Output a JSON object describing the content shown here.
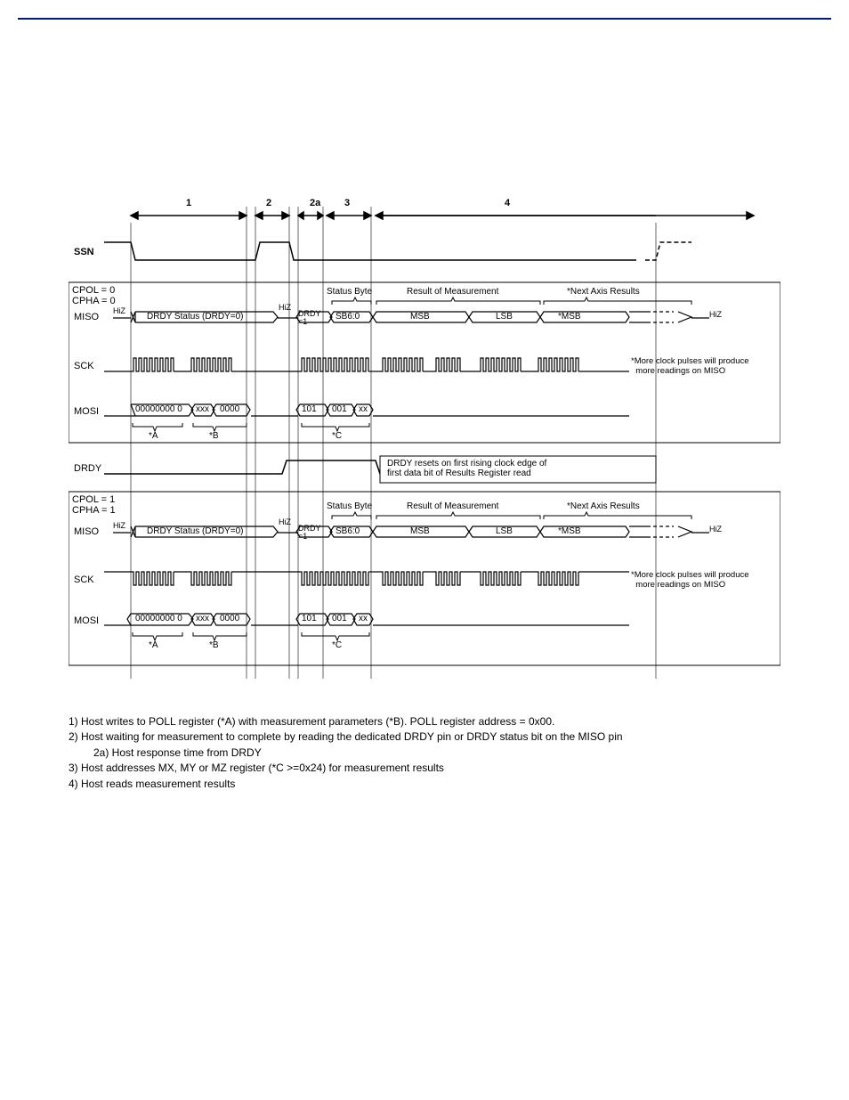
{
  "phases": {
    "p1": "1",
    "p2": "2",
    "p2a": "2a",
    "p3": "3",
    "p4": "4"
  },
  "signals": {
    "ssn": "SSN",
    "miso": "MISO",
    "sck": "SCK",
    "mosi": "MOSI",
    "drdy": "DRDY"
  },
  "mode0": {
    "cpol": "CPOL = 0",
    "cpha": "CPHA = 0"
  },
  "mode1": {
    "cpol": "CPOL = 1",
    "cpha": "CPHA = 1"
  },
  "labels": {
    "hiz": "HiZ",
    "drdy_status_eq0": "DRDY Status (DRDY=0)",
    "drdy_eq1": "DRDY\n=1",
    "sb60": "SB6:0",
    "msb": "MSB",
    "lsb": "LSB",
    "msb2": "*MSB",
    "status_byte": "Status Byte",
    "result_of_measurement": "Result of Measurement",
    "next_axis": "*Next Axis Results",
    "more_clock": "*More clock pulses will produce\n  more readings on MISO",
    "mosi_poll": "00000000  0",
    "mosi_xxx": "xxx",
    "mosi_zeros": "0000",
    "mosi_cmd1": "101",
    "mosi_cmd2": "001",
    "mosi_cmd3": "xx",
    "starA": "*A",
    "starB": "*B",
    "starC": "*C",
    "drdy_reset": "DRDY resets on first rising clock edge of\nfirst data bit of Results Register read"
  },
  "notes": {
    "n1": "1) Host writes to POLL register (*A) with measurement parameters (*B).  POLL register address = 0x00.",
    "n2": "2) Host waiting for measurement to complete by reading the dedicated DRDY pin or DRDY status bit on the MISO pin",
    "n2a": "2a) Host response time from DRDY",
    "n3": "3) Host addresses MX, MY or MZ register (*C >=0x24) for measurement results",
    "n4": "4) Host reads measurement results"
  }
}
